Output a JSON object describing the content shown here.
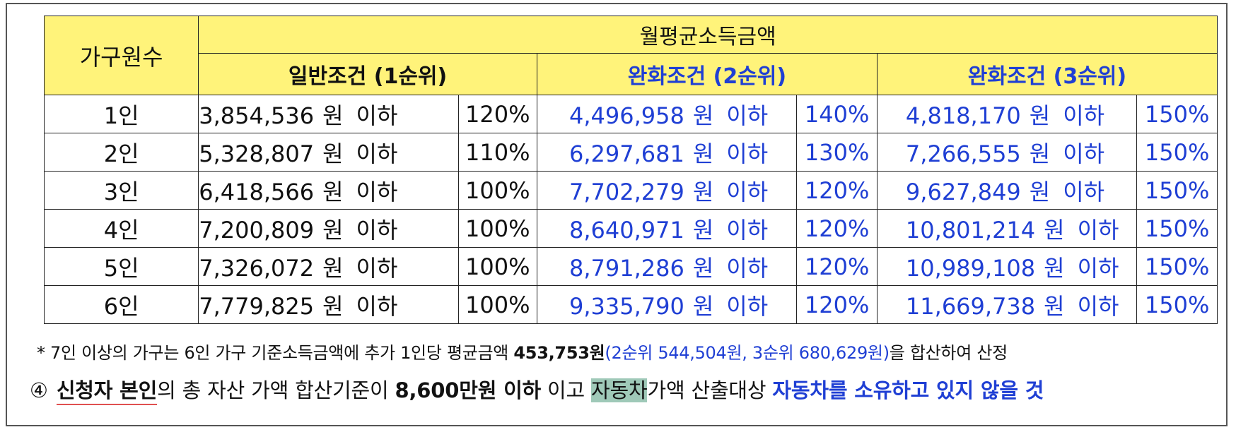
{
  "table": {
    "col_household": "가구원수",
    "col_group": "월평균소득금액",
    "conditions": [
      {
        "label": "일반조건 (1순위)"
      },
      {
        "label": "완화조건 (2순위)"
      },
      {
        "label": "완화조건 (3순위)"
      }
    ],
    "unit": "원",
    "below": "이하",
    "rows": [
      {
        "household": "1인",
        "c1": "3,854,536",
        "p1": "120%",
        "c2": "4,496,958",
        "p2": "140%",
        "c3": "4,818,170",
        "p3": "150%"
      },
      {
        "household": "2인",
        "c1": "5,328,807",
        "p1": "110%",
        "c2": "6,297,681",
        "p2": "130%",
        "c3": "7,266,555",
        "p3": "150%"
      },
      {
        "household": "3인",
        "c1": "6,418,566",
        "p1": "100%",
        "c2": "7,702,279",
        "p2": "120%",
        "c3": "9,627,849",
        "p3": "150%"
      },
      {
        "household": "4인",
        "c1": "7,200,809",
        "p1": "100%",
        "c2": "8,640,971",
        "p2": "120%",
        "c3": "10,801,214",
        "p3": "150%"
      },
      {
        "household": "5인",
        "c1": "7,326,072",
        "p1": "100%",
        "c2": "8,791,286",
        "p2": "120%",
        "c3": "10,989,108",
        "p3": "150%"
      },
      {
        "household": "6인",
        "c1": "7,779,825",
        "p1": "100%",
        "c2": "9,335,790",
        "p2": "120%",
        "c3": "11,669,738",
        "p3": "150%"
      }
    ]
  },
  "note": {
    "prefix": "* 7인 이상의 가구는 6인 가구 기준소득금액에 추가 1인당 평균금액 ",
    "amount": "453,753원",
    "paren": "(2순위 544,504원, 3순위 680,629원)",
    "suffix": "을 합산하여 산정"
  },
  "criteria": {
    "marker": "④",
    "subject": "신청자 본인",
    "text1": "의 총 자산 가액 합산기준이 ",
    "limit": "8,600만원 이하",
    "text2": " 이고 ",
    "car": "자동차",
    "text3": "가액 산출대상 ",
    "condition": "자동차를 소유하고 있지 않을 것"
  },
  "colors": {
    "header_bg": "#fff37a",
    "blue_text": "#1f3fd4",
    "highlight": "#9fc9b8",
    "underline": "#e05050"
  }
}
